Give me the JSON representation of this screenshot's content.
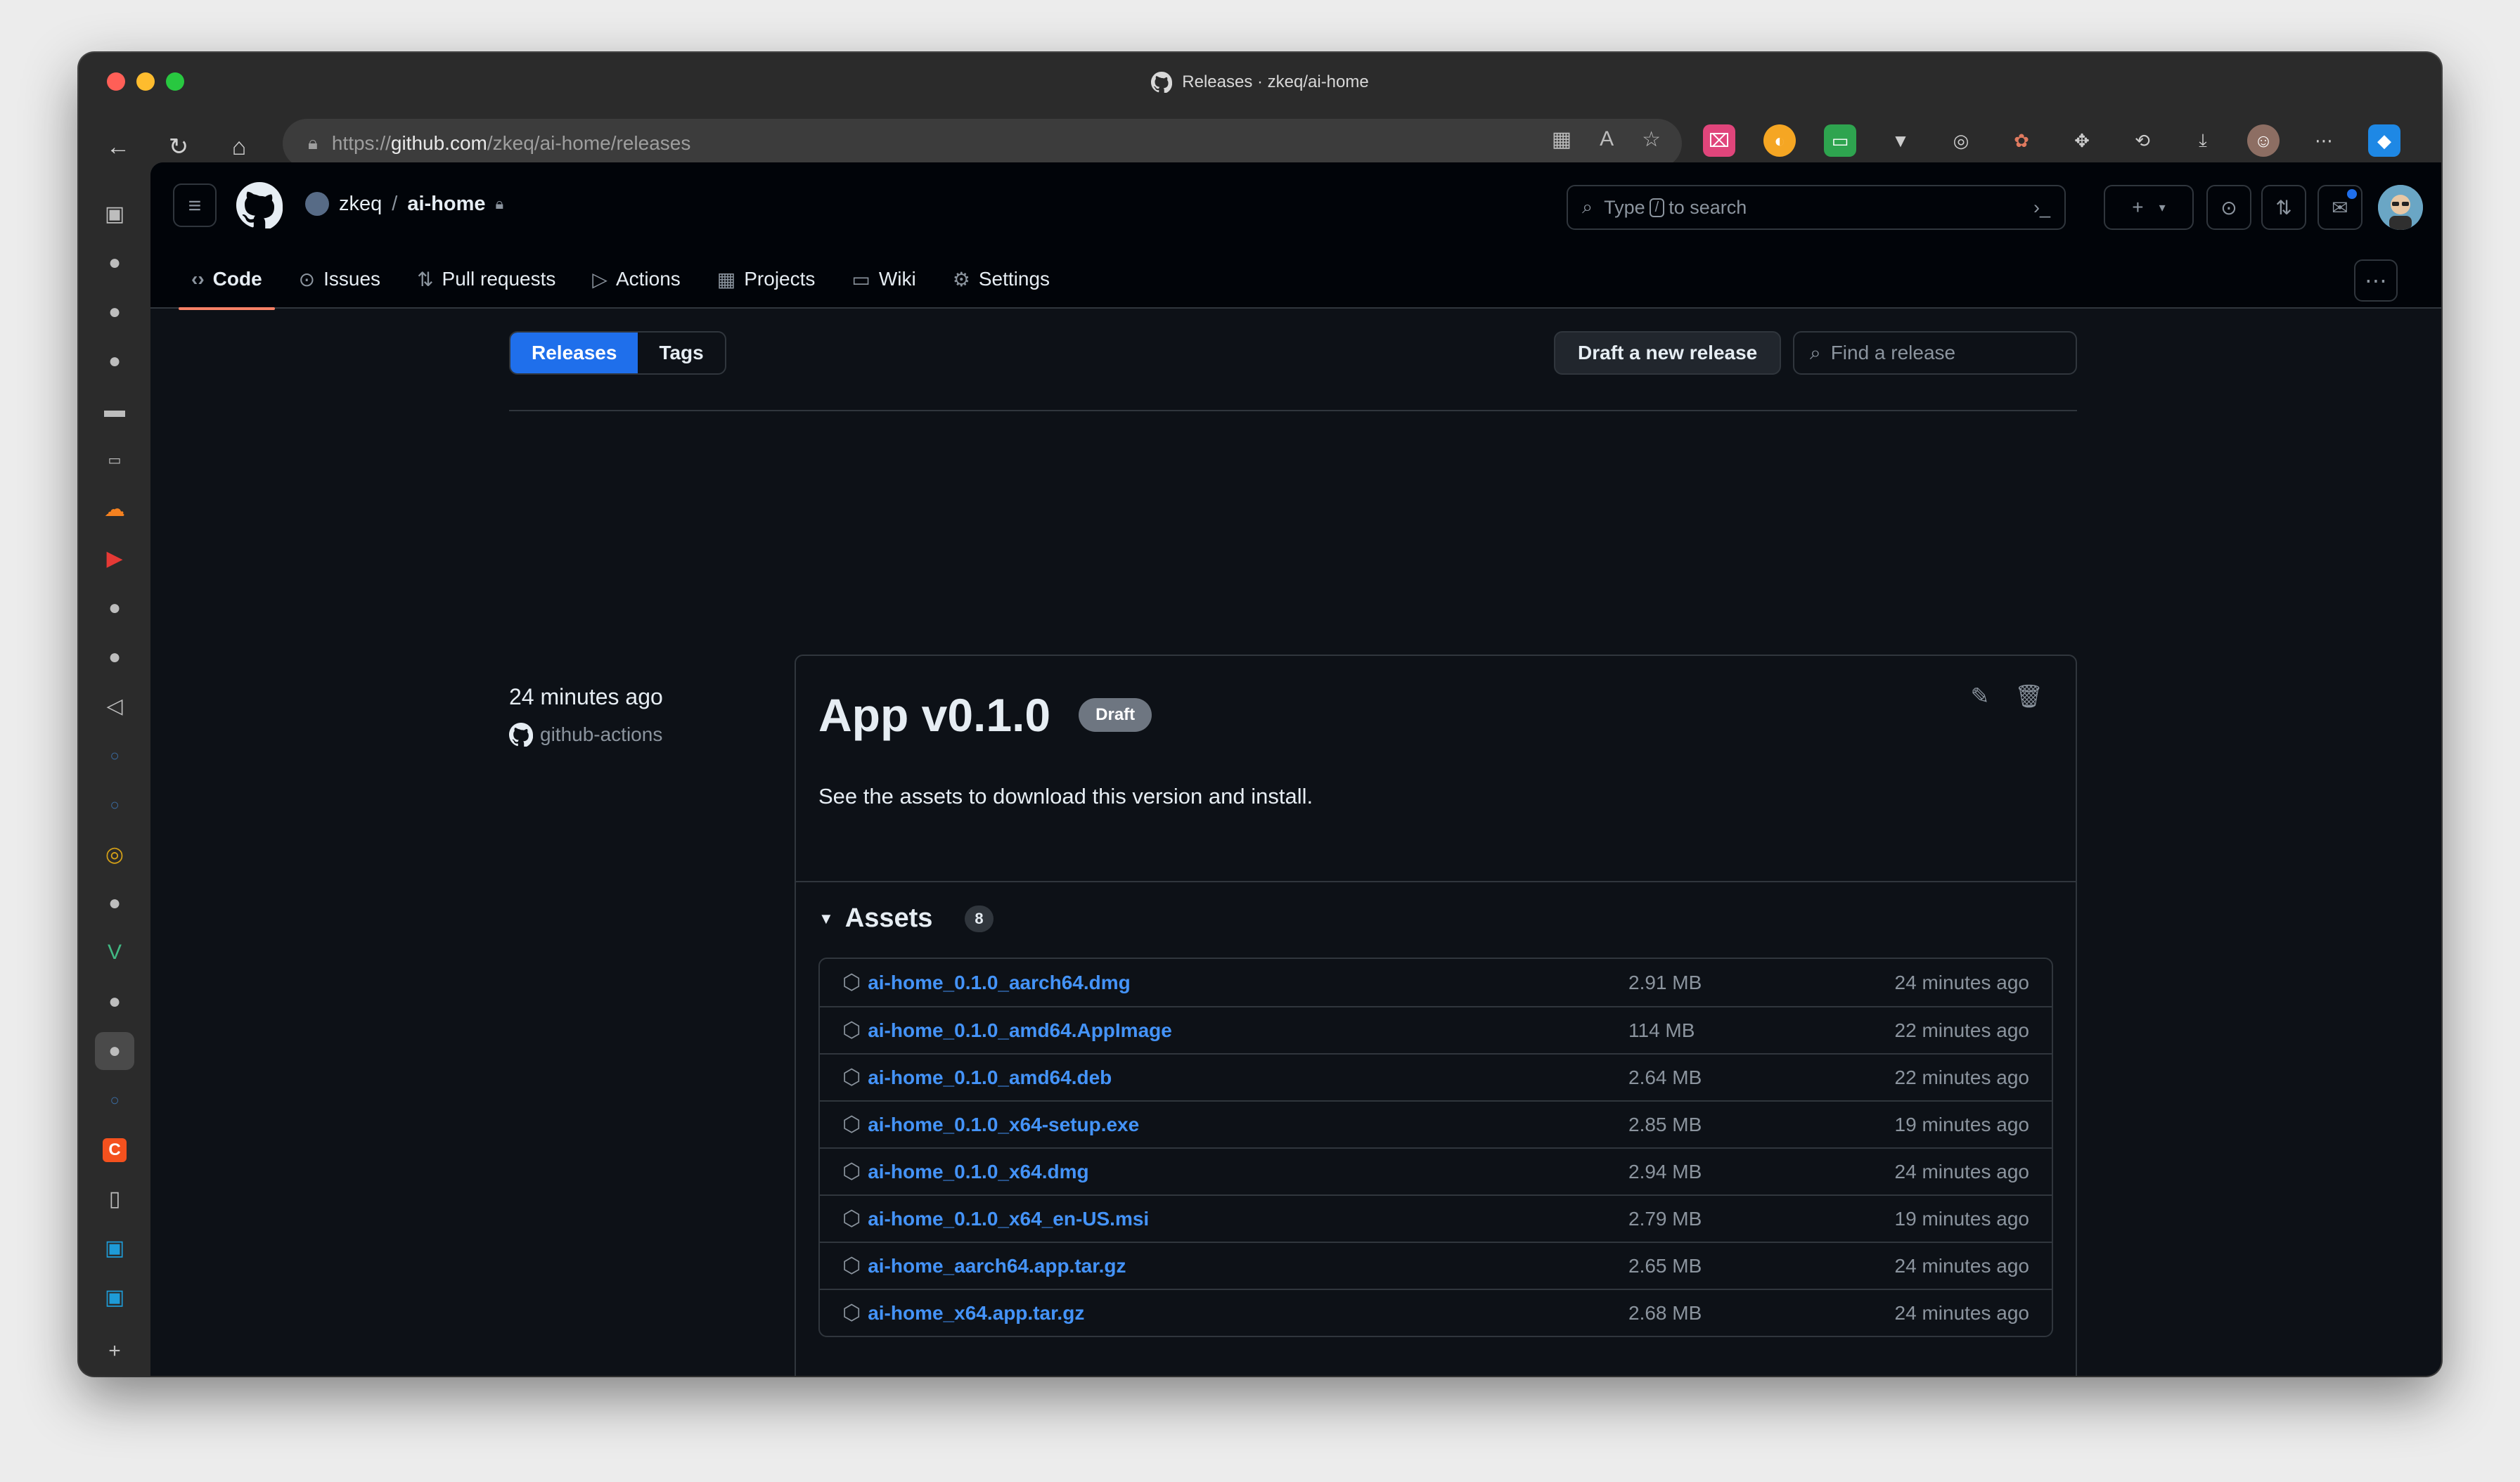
{
  "browser": {
    "window_title": "Releases · zkeq/ai-home",
    "url_prefix": "https://",
    "url_host": "github.com",
    "url_path": "/zkeq/ai-home/releases"
  },
  "repo": {
    "owner": "zkeq",
    "separator": "/",
    "name": "ai-home"
  },
  "search": {
    "before": "Type",
    "key": "/",
    "after": "to search"
  },
  "nav": {
    "tabs": [
      {
        "label": "Code",
        "icon": "code-icon"
      },
      {
        "label": "Issues",
        "icon": "issue-icon"
      },
      {
        "label": "Pull requests",
        "icon": "pull-request-icon"
      },
      {
        "label": "Actions",
        "icon": "play-icon"
      },
      {
        "label": "Projects",
        "icon": "table-icon"
      },
      {
        "label": "Wiki",
        "icon": "book-icon"
      },
      {
        "label": "Settings",
        "icon": "gear-icon"
      }
    ]
  },
  "releases_page": {
    "tab_releases": "Releases",
    "tab_tags": "Tags",
    "draft_button": "Draft a new release",
    "find_placeholder": "Find a release"
  },
  "release": {
    "time": "24 minutes ago",
    "author": "github-actions",
    "title": "App v0.1.0",
    "badge": "Draft",
    "description": "See the assets to download this version and install.",
    "assets_label": "Assets",
    "assets_count": "8",
    "assets": [
      {
        "name": "ai-home_0.1.0_aarch64.dmg",
        "size": "2.91 MB",
        "time": "24 minutes ago"
      },
      {
        "name": "ai-home_0.1.0_amd64.AppImage",
        "size": "114 MB",
        "time": "22 minutes ago"
      },
      {
        "name": "ai-home_0.1.0_amd64.deb",
        "size": "2.64 MB",
        "time": "22 minutes ago"
      },
      {
        "name": "ai-home_0.1.0_x64-setup.exe",
        "size": "2.85 MB",
        "time": "19 minutes ago"
      },
      {
        "name": "ai-home_0.1.0_x64.dmg",
        "size": "2.94 MB",
        "time": "24 minutes ago"
      },
      {
        "name": "ai-home_0.1.0_x64_en-US.msi",
        "size": "2.79 MB",
        "time": "19 minutes ago"
      },
      {
        "name": "ai-home_aarch64.app.tar.gz",
        "size": "2.65 MB",
        "time": "24 minutes ago"
      },
      {
        "name": "ai-home_x64.app.tar.gz",
        "size": "2.68 MB",
        "time": "24 minutes ago"
      }
    ]
  },
  "colors": {
    "accent": "#1f6feb",
    "link": "#4493f8",
    "tab_underline": "#f78166"
  }
}
